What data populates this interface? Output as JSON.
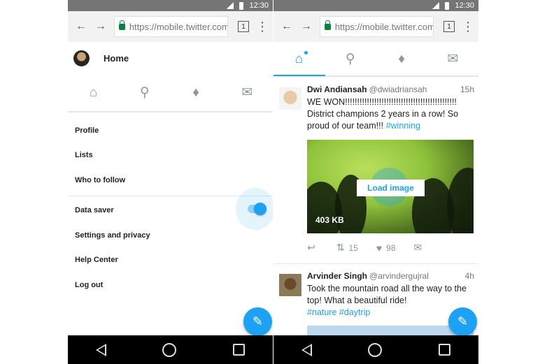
{
  "status": {
    "time": "12:30"
  },
  "browser": {
    "url": "https://mobile.twitter.com",
    "tab_count": "1"
  },
  "left": {
    "title": "Home",
    "menu": [
      "Profile",
      "Lists",
      "Who to follow"
    ],
    "menu2": [
      "Data saver",
      "Settings and privacy",
      "Help Center",
      "Log out"
    ]
  },
  "right": {
    "tweets": [
      {
        "name": "Dwi Andiansah",
        "handle": "@dwiadriansah",
        "time": "15h",
        "text_lines": [
          "WE WON!!!!!!!!!!!!!!!!!!!!!!!!!!!!!!!!!!!!!!!!!!!!!!",
          "District champions 2 years in a row! So",
          "proud of our team!!! "
        ],
        "hashtag": "#winning",
        "load_label": "Load image",
        "size_label": "403 KB",
        "retweets": "15",
        "likes": "98"
      },
      {
        "name": "Arvinder Singh",
        "handle": "@arvindergujral",
        "time": "4h",
        "text_lines": [
          "Took the mountain road all the way to the",
          "top! What a beautiful ride!"
        ],
        "hashtags": "#nature #daytrip"
      }
    ]
  },
  "colors": {
    "accent": "#1da1f2",
    "status_bar": "#757575",
    "icon_gray": "#8899a6"
  },
  "icons": [
    "back-icon",
    "forward-icon",
    "lock-icon",
    "home-icon",
    "search-icon",
    "notifications-icon",
    "messages-icon",
    "compose-icon",
    "reply-icon",
    "retweet-icon",
    "like-icon",
    "dm-icon"
  ]
}
